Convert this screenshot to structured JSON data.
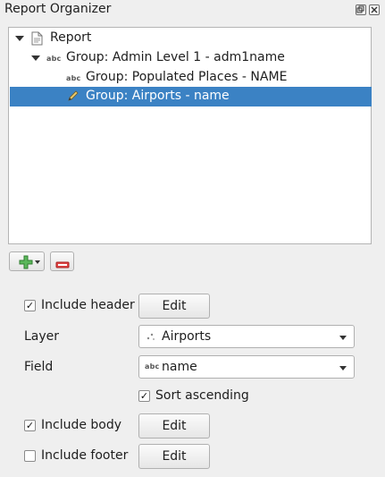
{
  "panel": {
    "title": "Report Organizer",
    "float_icon": "float-icon",
    "close_icon": "close-icon"
  },
  "tree": {
    "items": [
      {
        "label": "Report",
        "icon": "document-icon",
        "expanded": true
      },
      {
        "label": "Group: Admin Level 1 - adm1name",
        "icon_text": "abc",
        "expanded": true
      },
      {
        "label": "Group: Populated Places - NAME",
        "icon_text": "abc"
      },
      {
        "label": "Group: Airports - name",
        "icon": "pencil-icon",
        "selected": true
      }
    ]
  },
  "toolbar": {
    "add_icon": "plus-icon",
    "remove_icon": "minus-icon"
  },
  "form": {
    "include_header": {
      "label": "Include header",
      "checked": true,
      "edit_label": "Edit"
    },
    "layer": {
      "label": "Layer",
      "value": "Airports",
      "icon": "point-layer-icon"
    },
    "field": {
      "label": "Field",
      "value": "name",
      "icon_text": "abc"
    },
    "sort_ascending": {
      "label": "Sort ascending",
      "checked": true
    },
    "include_body": {
      "label": "Include body",
      "checked": true,
      "edit_label": "Edit"
    },
    "include_footer": {
      "label": "Include footer",
      "checked": false,
      "edit_label": "Edit"
    }
  },
  "colors": {
    "selection": "#3b82c4",
    "panel_bg": "#efefef",
    "add_icon": "#3aa13a",
    "remove_icon": "#d22b2b"
  }
}
